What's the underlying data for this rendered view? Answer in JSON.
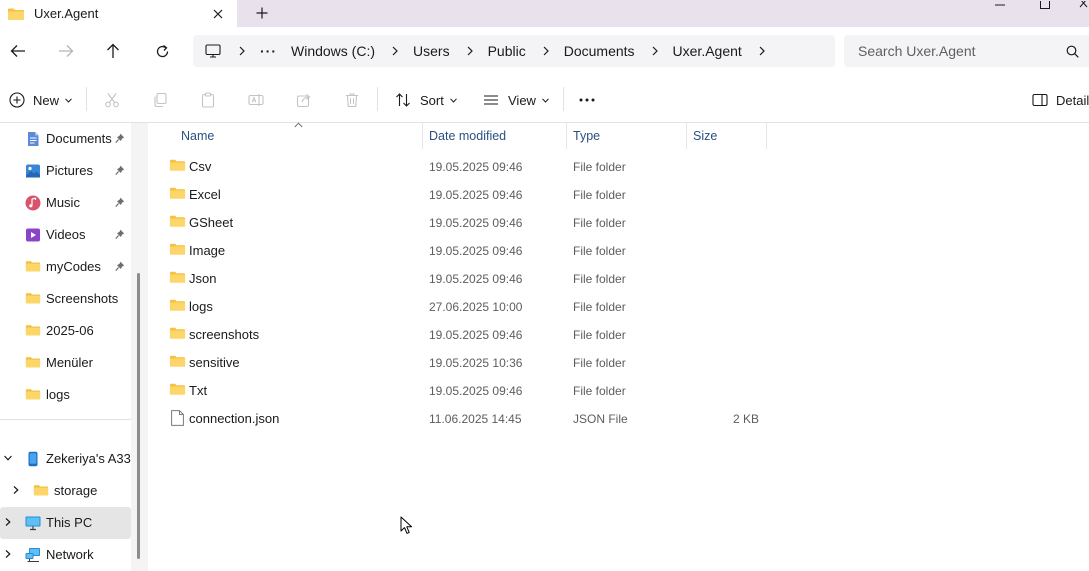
{
  "tab": {
    "title": "Uxer.Agent",
    "icon": "folder-icon"
  },
  "address": {
    "crumbs": [
      "Windows (C:)",
      "Users",
      "Public",
      "Documents",
      "Uxer.Agent"
    ],
    "more": "···"
  },
  "search": {
    "placeholder": "Search Uxer.Agent"
  },
  "commands": {
    "new": "New",
    "sort": "Sort",
    "view": "View",
    "details": "Details"
  },
  "sidebar": {
    "quick": [
      {
        "label": "Documents",
        "icon": "documents-icon",
        "pinned": true
      },
      {
        "label": "Pictures",
        "icon": "pictures-icon",
        "pinned": true
      },
      {
        "label": "Music",
        "icon": "music-icon",
        "pinned": true
      },
      {
        "label": "Videos",
        "icon": "videos-icon",
        "pinned": true
      },
      {
        "label": "myCodes",
        "icon": "folder-icon",
        "pinned": true
      },
      {
        "label": "Screenshots",
        "icon": "folder-icon",
        "pinned": false
      },
      {
        "label": "2025-06",
        "icon": "folder-icon",
        "pinned": false
      },
      {
        "label": "Menüler",
        "icon": "folder-icon",
        "pinned": false
      },
      {
        "label": "logs",
        "icon": "folder-icon",
        "pinned": false
      }
    ],
    "device": {
      "label": "Zekeriya's A33",
      "icon": "phone-icon"
    },
    "storage": {
      "label": "storage",
      "icon": "folder-icon"
    },
    "this_pc": {
      "label": "This PC",
      "icon": "computer-icon"
    },
    "network": {
      "label": "Network",
      "icon": "network-icon"
    }
  },
  "columns": {
    "name": "Name",
    "date": "Date modified",
    "type": "Type",
    "size": "Size"
  },
  "files": [
    {
      "name": "Csv",
      "date": "19.05.2025 09:46",
      "type": "File folder",
      "size": "",
      "icon": "folder-icon"
    },
    {
      "name": "Excel",
      "date": "19.05.2025 09:46",
      "type": "File folder",
      "size": "",
      "icon": "folder-icon"
    },
    {
      "name": "GSheet",
      "date": "19.05.2025 09:46",
      "type": "File folder",
      "size": "",
      "icon": "folder-icon"
    },
    {
      "name": "Image",
      "date": "19.05.2025 09:46",
      "type": "File folder",
      "size": "",
      "icon": "folder-icon"
    },
    {
      "name": "Json",
      "date": "19.05.2025 09:46",
      "type": "File folder",
      "size": "",
      "icon": "folder-icon"
    },
    {
      "name": "logs",
      "date": "27.06.2025 10:00",
      "type": "File folder",
      "size": "",
      "icon": "folder-icon"
    },
    {
      "name": "screenshots",
      "date": "19.05.2025 09:46",
      "type": "File folder",
      "size": "",
      "icon": "folder-icon"
    },
    {
      "name": "sensitive",
      "date": "19.05.2025 10:36",
      "type": "File folder",
      "size": "",
      "icon": "folder-icon"
    },
    {
      "name": "Txt",
      "date": "19.05.2025 09:46",
      "type": "File folder",
      "size": "",
      "icon": "folder-icon"
    },
    {
      "name": "connection.json",
      "date": "11.06.2025 14:45",
      "type": "JSON File",
      "size": "2 KB",
      "icon": "file-icon"
    }
  ],
  "colors": {
    "folder": "#f5c242",
    "accent": "#0067c0",
    "header_text": "#2b4f82",
    "tab_strip": "#e9e1ec",
    "selection": "#e5e5e5"
  }
}
